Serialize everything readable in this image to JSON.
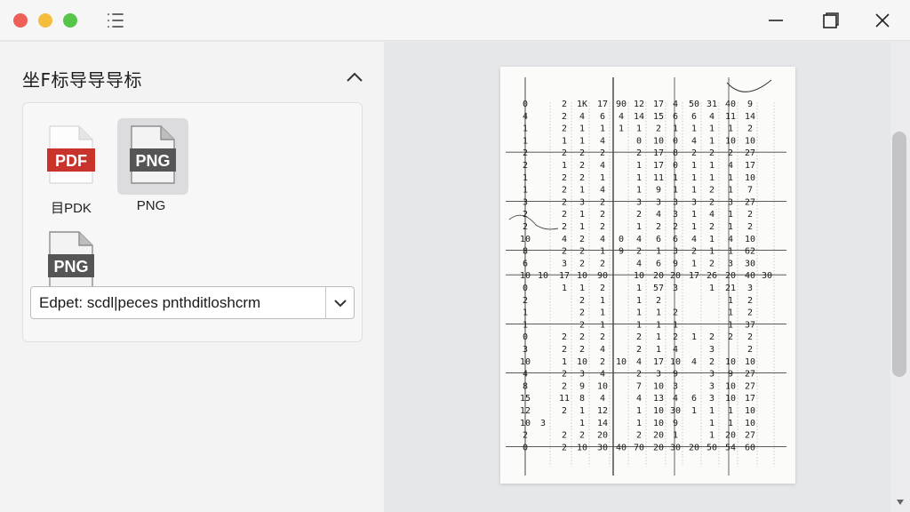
{
  "window": {
    "controls": [
      "close",
      "minimize",
      "maximize"
    ],
    "toolbar_icon": "list-icon"
  },
  "sidebar": {
    "title": "坐F标导导导标",
    "files": [
      {
        "badge": "PDF",
        "label": "目PDK",
        "color": "#c8342b",
        "selected": false
      },
      {
        "badge": "PNG",
        "label": "PNG",
        "color": "#555555",
        "selected": true
      },
      {
        "badge": "PNG",
        "label": "",
        "color": "#555555",
        "selected": false
      }
    ],
    "export_select": {
      "value": "Edpet: scdl|peces pnthditloshcrm"
    }
  },
  "document": {
    "rows": [
      [
        "0",
        "",
        "2",
        "1K",
        "17",
        "90",
        "12",
        "17",
        "4",
        "50",
        "31",
        "40",
        "9"
      ],
      [
        "4",
        "",
        "2",
        "4",
        "6",
        "4",
        "14",
        "15",
        "6",
        "6",
        "4",
        "11",
        "14"
      ],
      [
        "1",
        "",
        "2",
        "1",
        "1",
        "1",
        "1",
        "2",
        "1",
        "1",
        "1",
        "1",
        "2"
      ],
      [
        "1",
        "",
        "1",
        "1",
        "4",
        "",
        "0",
        "10",
        "0",
        "4",
        "1",
        "10",
        "10"
      ],
      [
        "2",
        "",
        "2",
        "2",
        "2",
        "",
        "2",
        "17",
        "8",
        "2",
        "2",
        "2",
        "27"
      ],
      [
        "2",
        "",
        "1",
        "2",
        "4",
        "",
        "1",
        "17",
        "0",
        "1",
        "1",
        "4",
        "17"
      ],
      [
        "1",
        "",
        "2",
        "2",
        "1",
        "",
        "1",
        "11",
        "1",
        "1",
        "1",
        "1",
        "10"
      ],
      [
        "1",
        "",
        "2",
        "1",
        "4",
        "",
        "1",
        "9",
        "1",
        "1",
        "2",
        "1",
        "7"
      ],
      [
        "3",
        "",
        "2",
        "3",
        "2",
        "",
        "3",
        "3",
        "3",
        "3",
        "2",
        "3",
        "27"
      ],
      [
        "2",
        "",
        "2",
        "1",
        "2",
        "",
        "2",
        "4",
        "3",
        "1",
        "4",
        "1",
        "2"
      ],
      [
        "2",
        "",
        "2",
        "1",
        "2",
        "",
        "1",
        "2",
        "2",
        "1",
        "2",
        "1",
        "2"
      ],
      [
        "10",
        "",
        "4",
        "2",
        "4",
        "0",
        "4",
        "6",
        "6",
        "4",
        "1",
        "4",
        "10"
      ],
      [
        "8",
        "",
        "2",
        "2",
        "1",
        "9",
        "2",
        "1",
        "3",
        "2",
        "1",
        "1",
        "62"
      ],
      [
        "6",
        "",
        "3",
        "2",
        "2",
        "",
        "4",
        "6",
        "9",
        "1",
        "2",
        "3",
        "30"
      ],
      [
        "10",
        "10",
        "17",
        "10",
        "90",
        "",
        "10",
        "20",
        "20",
        "17",
        "26",
        "20",
        "40",
        "30"
      ],
      [
        "0",
        "",
        "1",
        "1",
        "2",
        "",
        "1",
        "57",
        "3",
        "",
        "1",
        "21",
        "3"
      ],
      [
        "2",
        "",
        "",
        "2",
        "1",
        "",
        "1",
        "2",
        "",
        "",
        "",
        "1",
        "2"
      ],
      [
        "1",
        "",
        "",
        "2",
        "1",
        "",
        "1",
        "1",
        "2",
        "",
        "",
        "1",
        "2"
      ],
      [
        "1",
        "",
        "",
        "2",
        "1",
        "",
        "1",
        "1",
        "1",
        "",
        "",
        "1",
        "37"
      ],
      [
        "0",
        "",
        "2",
        "2",
        "2",
        "",
        "2",
        "1",
        "2",
        "1",
        "2",
        "2",
        "2"
      ],
      [
        "3",
        "",
        "2",
        "2",
        "4",
        "",
        "2",
        "1",
        "4",
        "",
        "3",
        "",
        "2"
      ],
      [
        "10",
        "",
        "1",
        "10",
        "2",
        "10",
        "4",
        "17",
        "10",
        "4",
        "2",
        "10",
        "10"
      ],
      [
        "4",
        "",
        "2",
        "3",
        "4",
        "",
        "2",
        "3",
        "9",
        "",
        "3",
        "9",
        "27"
      ],
      [
        "8",
        "",
        "2",
        "9",
        "10",
        "",
        "7",
        "10",
        "3",
        "",
        "3",
        "10",
        "27"
      ],
      [
        "15",
        "",
        "11",
        "8",
        "4",
        "",
        "4",
        "13",
        "4",
        "6",
        "3",
        "10",
        "17"
      ],
      [
        "12",
        "",
        "2",
        "1",
        "12",
        "",
        "1",
        "10",
        "30",
        "1",
        "1",
        "1",
        "10"
      ],
      [
        "10",
        "3",
        "",
        "1",
        "14",
        "",
        "1",
        "10",
        "9",
        "",
        "1",
        "1",
        "10"
      ],
      [
        "2",
        "",
        "2",
        "2",
        "20",
        "",
        "2",
        "20",
        "1",
        "",
        "1",
        "20",
        "27"
      ],
      [
        "0",
        "",
        "2",
        "10",
        "30",
        "40",
        "70",
        "20",
        "30",
        "20",
        "50",
        "54",
        "60"
      ]
    ]
  }
}
